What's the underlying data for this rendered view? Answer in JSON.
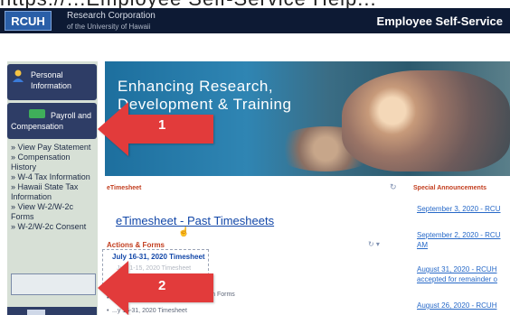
{
  "top_strip_text": "https://...Employee Self-Service Help...",
  "header": {
    "logo_text": "RCUH",
    "org_line1": "Research Corporation",
    "org_line2": "of the University of Hawaii",
    "right_title": "Employee Self-Service"
  },
  "sidebar": {
    "personal_label": "Personal Information",
    "payroll_label": "Payroll and Compensation",
    "submenu": [
      "» View Pay Statement",
      "» Compensation History",
      "» W-4 Tax Information",
      "» Hawaii State Tax Information",
      "» View W-2/W-2c Forms",
      "» W-2/W-2c Consent"
    ]
  },
  "banner": {
    "line1": "Enhancing Research,",
    "line2": "Development & Training"
  },
  "etimesheet": {
    "section_label": "eTimesheet",
    "past_link": "eTimesheet - Past Timesheets",
    "actions_label": "Actions & Forms",
    "timesheet_link": "July 16-31, 2020 Timesheet",
    "faint_line": "July 1-15, 2020 Timesheet",
    "forms_text": "...fication Forms",
    "timesheet_bottom": "...y 16-31, 2020 Timesheet"
  },
  "announcements": {
    "title": "Special Announcements",
    "items": [
      "September 3, 2020 - RCU",
      "September 2, 2020 - RCU",
      "AM",
      "August 31, 2020 - RCUH",
      "accepted for remainder o",
      "August 26, 2020 - RCUH"
    ]
  },
  "arrows": [
    {
      "number": "1"
    },
    {
      "number": "2"
    }
  ],
  "colors": {
    "header_bg": "#0d1a34",
    "nav_bg": "#2e3d66",
    "sidebar_bg": "#d7e0d6",
    "arrow_red": "#e23b3b",
    "link_blue": "#1247a8",
    "section_red": "#c23d1e"
  },
  "icons": {
    "personal": "person-icon",
    "payroll": "money-icon",
    "refresh": "refresh-icon"
  }
}
